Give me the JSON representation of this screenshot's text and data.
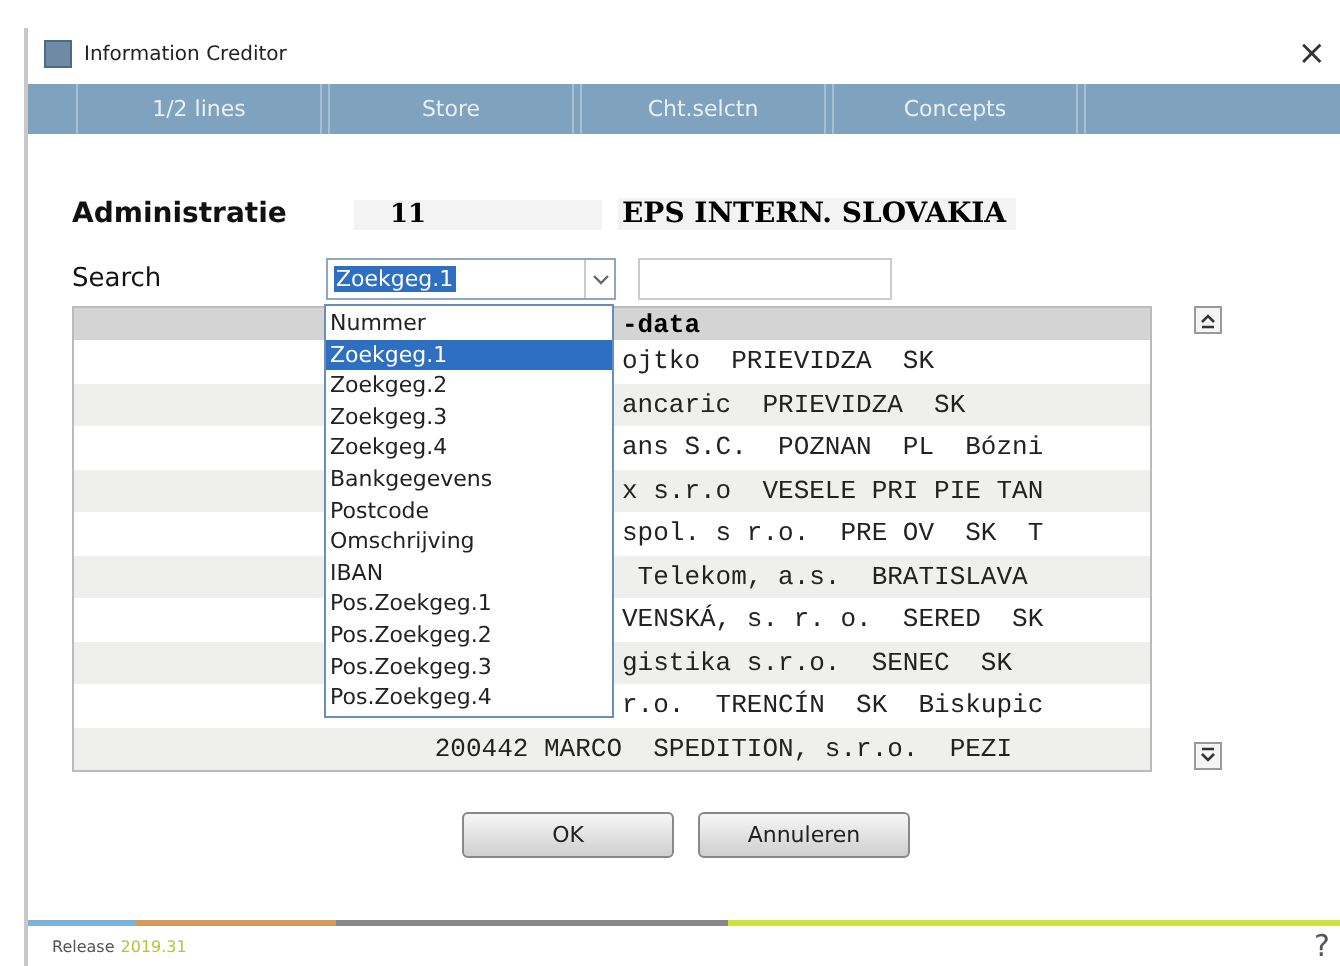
{
  "window": {
    "title": "Information Creditor",
    "close": "×"
  },
  "menu": [
    {
      "label": "1/2 lines"
    },
    {
      "label": "Store"
    },
    {
      "label": "Cht.selctn"
    },
    {
      "label": "Concepts"
    }
  ],
  "administration": {
    "label": "Administratie",
    "number": "11",
    "name": "EPS INTERN. SLOVAKIA"
  },
  "search": {
    "label": "Search",
    "value": "Zoekgeg.1",
    "expanded": true
  },
  "search_options": [
    {
      "label": "Nummer",
      "selected": false
    },
    {
      "label": "Zoekgeg.1",
      "selected": true
    },
    {
      "label": "Zoekgeg.2",
      "selected": false
    },
    {
      "label": "Zoekgeg.3",
      "selected": false
    },
    {
      "label": "Zoekgeg.4",
      "selected": false
    },
    {
      "label": "Bankgegevens",
      "selected": false
    },
    {
      "label": "Postcode",
      "selected": false
    },
    {
      "label": "Omschrijving",
      "selected": false
    },
    {
      "label": "IBAN",
      "selected": false
    },
    {
      "label": "Pos.Zoekgeg.1",
      "selected": false
    },
    {
      "label": "Pos.Zoekgeg.2",
      "selected": false
    },
    {
      "label": "Pos.Zoekgeg.3",
      "selected": false
    },
    {
      "label": "Pos.Zoekgeg.4",
      "selected": false
    }
  ],
  "table": {
    "header": "-data",
    "rows": [
      {
        "column_2": "ojtko  PRIEVIDZA  SK"
      },
      {
        "column_2": "ancaric  PRIEVIDZA  SK"
      },
      {
        "column_2": "ans S.C.  POZNAN  PL  Bózni"
      },
      {
        "column_2": "x s.r.o  VESELE PRI PIE TAN"
      },
      {
        "column_2": "spol. s r.o.  PRE OV  SK  T"
      },
      {
        "column_2": " Telekom, a.s.  BRATISLAVA"
      },
      {
        "column_2": "VENSKÁ, s. r. o.  SERED  SK"
      },
      {
        "column_2": "gistika s.r.o.  SENEC  SK"
      },
      {
        "column_2": "r.o.  TRENCÍN  SK  Biskupic"
      },
      {
        "column_1": "200442 MARCO",
        "column_2": "  SPEDITION, s.r.o.  PEZI"
      }
    ]
  },
  "buttons": [
    {
      "label": "OK"
    },
    {
      "label": "Annuleren"
    }
  ],
  "footer": {
    "release_label": "Release",
    "release_version": "2019.31",
    "help": "?"
  }
}
